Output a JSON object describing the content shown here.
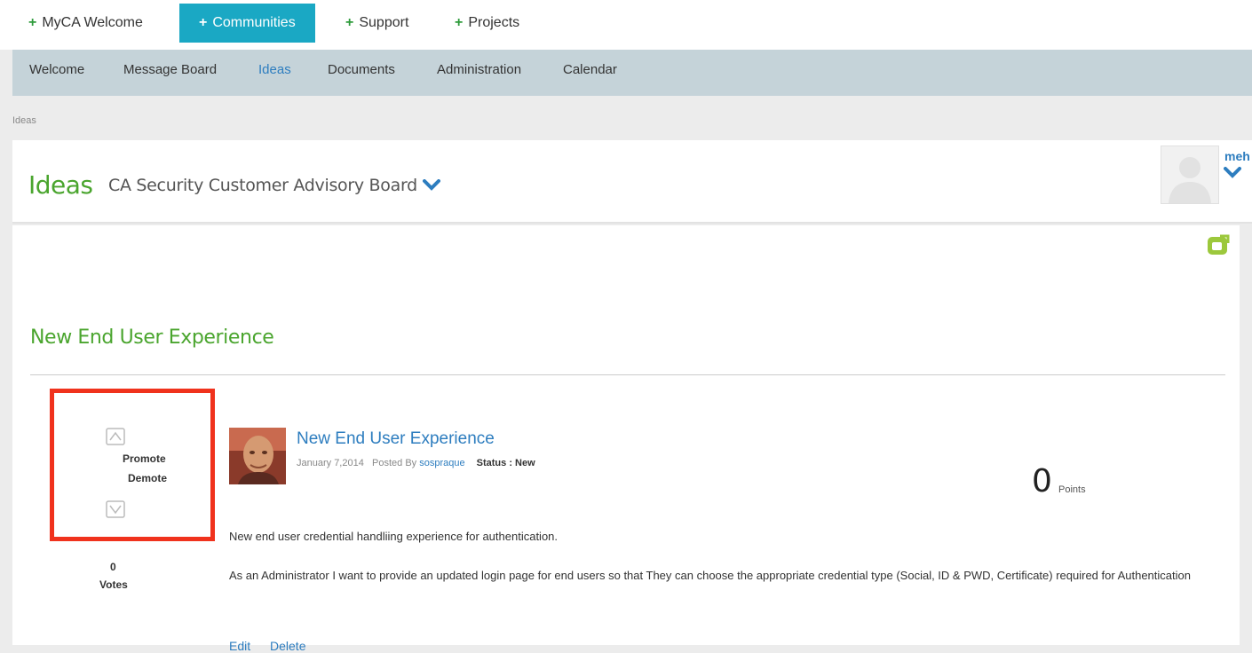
{
  "topnav": {
    "tabs": [
      {
        "label": "MyCA Welcome"
      },
      {
        "label": "Communities"
      },
      {
        "label": "Support"
      },
      {
        "label": "Projects"
      }
    ]
  },
  "subnav": {
    "items": [
      {
        "label": "Welcome"
      },
      {
        "label": "Message Board"
      },
      {
        "label": "Ideas"
      },
      {
        "label": "Documents"
      },
      {
        "label": "Administration"
      },
      {
        "label": "Calendar"
      }
    ]
  },
  "breadcrumb": "Ideas",
  "header": {
    "title": "Ideas",
    "board": "CA Security Customer Advisory Board",
    "user_name": "meh"
  },
  "section": {
    "title": "New End User Experience"
  },
  "idea": {
    "promote_label": "Promote",
    "demote_label": "Demote",
    "vote_count": "0",
    "votes_label": "Votes",
    "title": "New End User Experience",
    "date": "January 7,2014",
    "posted_by_label": "Posted By",
    "poster": "sospraque",
    "status": "Status : New",
    "points": "0",
    "points_label": "Points",
    "summary": "New end user credential handliing experience for authentication.",
    "description": "As an Administrator I want to provide an updated login page for end users so that They can choose the appropriate credential type (Social, ID & PWD, Certificate) required for Authentication",
    "edit_label": "Edit",
    "delete_label": "Delete"
  },
  "colors": {
    "accent_blue": "#1aa8c4",
    "brand_green": "#4aa52e",
    "link_blue": "#2d7dbf",
    "highlight_red": "#f0321d"
  }
}
